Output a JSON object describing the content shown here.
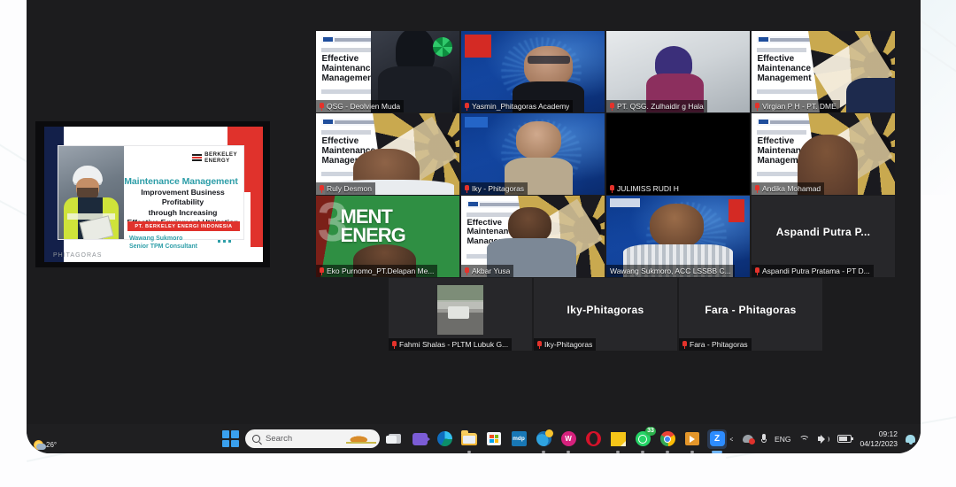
{
  "meeting": {
    "app": "zoom-meeting",
    "participants_row1": [
      {
        "name": "QSG - Deolvien Muda",
        "bg": "slide-gear",
        "muted": true,
        "speaking": false
      },
      {
        "name": "Yasmin_Phitagoras Academy",
        "bg": "blue-tech",
        "muted": true,
        "speaking": false
      },
      {
        "name": "PT. QSG. Zulhaidir g Hala",
        "bg": "photo-person",
        "muted": true,
        "speaking": false
      },
      {
        "name": "Virgian P H - PT. DME",
        "bg": "slide-gear",
        "muted": true,
        "speaking": false
      }
    ],
    "participants_row2": [
      {
        "name": "Ruly Desmon",
        "bg": "slide-gear",
        "muted": true,
        "speaking": false
      },
      {
        "name": "Iky - Phitagoras",
        "bg": "blue-tech",
        "muted": true,
        "speaking": false
      },
      {
        "name": "JULIMISS RUDI H",
        "bg": "black",
        "muted": true,
        "speaking": false
      },
      {
        "name": "Andika Mohamad",
        "bg": "slide-gear",
        "muted": true,
        "speaking": false
      }
    ],
    "participants_row3": [
      {
        "name": "Eko Purnomo_PT.Delapan Me...",
        "bg": "green-banner",
        "muted": true,
        "speaking": false
      },
      {
        "name": "Akbar Yusa",
        "bg": "slide-gear",
        "muted": true,
        "speaking": false
      },
      {
        "name": "Wawang Sukmoro, ACC LSSBB C...",
        "bg": "blue-tech",
        "muted": false,
        "speaking": true
      },
      {
        "name": "Aspandi Putra Pratama - PT D...",
        "display_name": "Aspandi Putra P...",
        "bg": "name-only",
        "muted": true,
        "speaking": false
      }
    ],
    "participants_row4": [
      {
        "name": "Fahmi Shalas - PLTM Lubuk G...",
        "bg": "thumbnail-photo",
        "muted": true,
        "speaking": false
      },
      {
        "name": "Iky-Phitagoras",
        "display_name": "Iky-Phitagoras",
        "bg": "name-only",
        "muted": true,
        "speaking": false
      },
      {
        "name": "Fara - Phitagoras",
        "display_name": "Fara - Phitagoras",
        "bg": "name-only",
        "muted": true,
        "speaking": false
      }
    ],
    "colors": {
      "speaking_border": "#d8e21c",
      "mute_icon": "#e4322b",
      "tile_background": "#000000",
      "desktop_background": "#1c1c1e"
    }
  },
  "presentation": {
    "brand": "BERKELEY ENERGY",
    "brand_line1": "BERKELEY",
    "brand_line2": "ENERGY",
    "title": "Maintenance Management",
    "subtitle_line1": "Improvement Business Profitability",
    "subtitle_line2": "through Increasing",
    "subtitle_line3": "Effective Equipment Utilization",
    "ribbon": "PT. BERKELEY ENERGI INDONESIA",
    "presenter_name": "Wawang Sukmoro",
    "presenter_role": "Senior TPM Consultant",
    "watermark": "PHITAGORAS",
    "accent_teal": "#2e9ea8",
    "accent_red": "#e0322c",
    "accent_navy": "#13204a"
  },
  "slide_overlay": {
    "kicker": "In-House Training",
    "line1": "Effective",
    "line2": "Maintenance",
    "line3": "Management",
    "logo": "PHITAGORAS 20"
  },
  "green_banner": {
    "numeral": "3",
    "line1": "MENT",
    "line2": "ENERG"
  },
  "taskbar": {
    "weather_temp": "26°",
    "search_placeholder": "Search",
    "icons": [
      {
        "name": "start-button",
        "label": "Start"
      },
      {
        "name": "search-input",
        "label": "Search"
      },
      {
        "name": "task-view-button",
        "label": "Task View"
      },
      {
        "name": "teams-icon",
        "label": "Chat"
      },
      {
        "name": "edge-icon",
        "label": "Microsoft Edge"
      },
      {
        "name": "file-explorer-icon",
        "label": "File Explorer"
      },
      {
        "name": "microsoft-store-icon",
        "label": "Microsoft Store"
      },
      {
        "name": "mdp-app-icon",
        "label": "mdp"
      },
      {
        "name": "mail-app-icon",
        "label": "Mail"
      },
      {
        "name": "wps-office-icon",
        "label": "WPS Office"
      },
      {
        "name": "opera-icon",
        "label": "Opera"
      },
      {
        "name": "sticky-notes-icon",
        "label": "Sticky Notes"
      },
      {
        "name": "whatsapp-icon",
        "label": "WhatsApp",
        "badge": "33"
      },
      {
        "name": "chrome-icon",
        "label": "Google Chrome"
      },
      {
        "name": "media-player-icon",
        "label": "Media Player"
      },
      {
        "name": "zoom-icon",
        "label": "Zoom",
        "active": true
      }
    ],
    "tray": {
      "overflow": "^",
      "language": "ENG",
      "time": "09:12",
      "date": "04/12/2023"
    }
  }
}
